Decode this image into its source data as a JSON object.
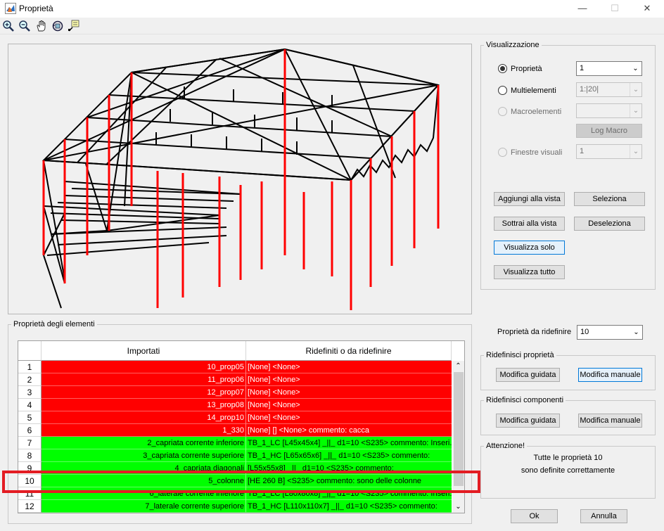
{
  "window": {
    "title": "Proprietà",
    "controls": {
      "minimize": "—",
      "maximize": "☐",
      "close": "✕"
    }
  },
  "toolbar": {
    "tools": [
      "zoom-in-icon",
      "zoom-out-icon",
      "pan-hand-icon",
      "rotate-3d-icon",
      "data-cursor-icon"
    ]
  },
  "visualizzazione": {
    "legend": "Visualizzazione",
    "proprieta": {
      "label": "Proprietà",
      "value": "1",
      "checked": true
    },
    "multielementi": {
      "label": "Multielementi",
      "value": "1:|20|"
    },
    "macroelementi": {
      "label": "Macroelementi",
      "value": ""
    },
    "log_macro": "Log Macro",
    "finestre_visuali": {
      "label": "Finestre visuali",
      "value": "1"
    },
    "buttons": {
      "aggiungi": "Aggiungi alla vista",
      "seleziona": "Seleziona",
      "sottrai": "Sottrai alla vista",
      "deseleziona": "Deseleziona",
      "visualizza_solo": "Visualizza solo",
      "visualizza_tutto": "Visualizza tutto"
    }
  },
  "table_panel": {
    "legend": "Proprietà degli elementi",
    "columns": [
      "Importati",
      "Ridefiniti o da ridefinire"
    ],
    "rows": [
      {
        "num": "1",
        "imported": "10_prop05",
        "redefined": "[None]  <None>",
        "status": "red"
      },
      {
        "num": "2",
        "imported": "11_prop06",
        "redefined": "[None]  <None>",
        "status": "red"
      },
      {
        "num": "3",
        "imported": "12_prop07",
        "redefined": "[None]  <None>",
        "status": "red"
      },
      {
        "num": "4",
        "imported": "13_prop08",
        "redefined": "[None]  <None>",
        "status": "red"
      },
      {
        "num": "5",
        "imported": "14_prop10",
        "redefined": "[None]  <None>",
        "status": "red"
      },
      {
        "num": "6",
        "imported": "1_330",
        "redefined": "[None] [] <None> commento: cacca",
        "status": "red"
      },
      {
        "num": "7",
        "imported": "2_capriata corrente inferiore",
        "redefined": "TB_1_LC  [L45x45x4] _||_ d1=10 <S235> commento: Inseri...",
        "status": "green"
      },
      {
        "num": "8",
        "imported": "3_capriata corrente superiore",
        "redefined": "TB_1_HC  [L65x65x6] _||_ d1=10 <S235> commento:",
        "status": "green"
      },
      {
        "num": "9",
        "imported": "4_capriata diagonali",
        "redefined": "[L55x55x8] _||_ d1=10 <S235> commento:",
        "status": "green"
      },
      {
        "num": "10",
        "imported": "5_colonne",
        "redefined": "[HE 260 B]  <S235> commento: sono delle colonne",
        "status": "green"
      },
      {
        "num": "11",
        "imported": "6_laterale corrente inferiore",
        "redefined": "TB_1_LC [L80x80x8] _||_ d1=10 <S235> commento: Inseri...",
        "status": "green"
      },
      {
        "num": "12",
        "imported": "7_laterale corrente superiore",
        "redefined": "TB_1_HC  [L110x110x7] _||_ d1=10 <S235> commento:",
        "status": "green"
      }
    ]
  },
  "ridefinire": {
    "label": "Proprietà da ridefinire",
    "value": "10"
  },
  "ridefinisci_proprieta": {
    "legend": "Ridefinisci proprietà",
    "guidata": "Modifica guidata",
    "manuale": "Modifica manuale"
  },
  "ridefinisci_componenti": {
    "legend": "Ridefinisci componenti",
    "guidata": "Modifica guidata",
    "manuale": "Modifica manuale"
  },
  "attenzione": {
    "legend": "Attenzione!",
    "line1": "Tutte le proprietà 10",
    "line2": "sono definite correttamente"
  },
  "footer": {
    "ok": "Ok",
    "annulla": "Annulla"
  },
  "colors": {
    "row_error": "#ff0000",
    "row_ok": "#00ff00",
    "highlight": "#e31c23",
    "member_highlight": "#ff0000"
  }
}
